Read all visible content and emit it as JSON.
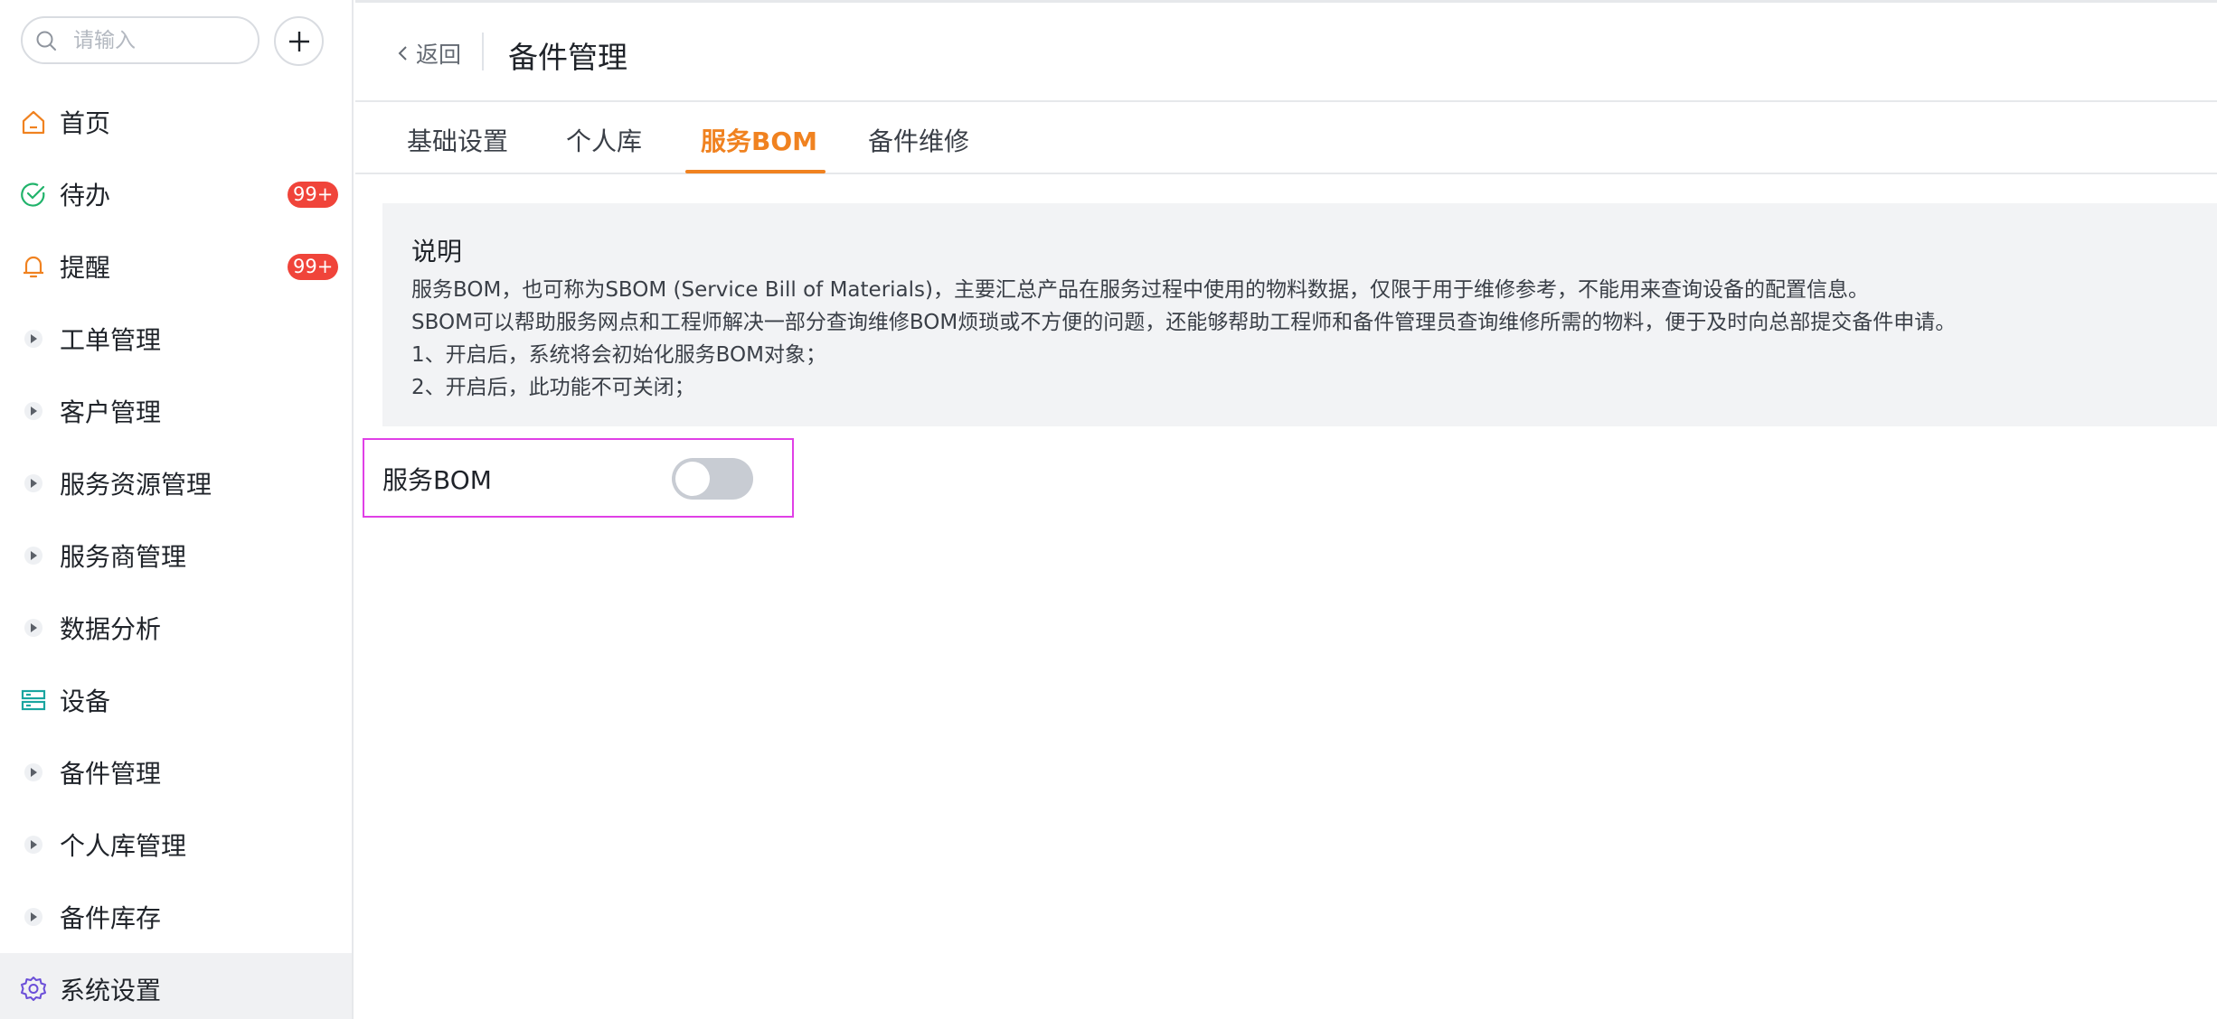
{
  "search": {
    "placeholder": "请输入"
  },
  "nav": {
    "items": [
      {
        "label": "首页",
        "icon": "home-icon"
      },
      {
        "label": "待办",
        "icon": "check-circle-icon",
        "badge": "99+"
      },
      {
        "label": "提醒",
        "icon": "bell-icon",
        "badge": "99+"
      },
      {
        "label": "工单管理",
        "icon": "caret-right-icon"
      },
      {
        "label": "客户管理",
        "icon": "caret-right-icon"
      },
      {
        "label": "服务资源管理",
        "icon": "caret-right-icon"
      },
      {
        "label": "服务商管理",
        "icon": "caret-right-icon"
      },
      {
        "label": "数据分析",
        "icon": "caret-right-icon"
      },
      {
        "label": "设备",
        "icon": "server-icon"
      },
      {
        "label": "备件管理",
        "icon": "caret-right-icon"
      },
      {
        "label": "个人库管理",
        "icon": "caret-right-icon"
      },
      {
        "label": "备件库存",
        "icon": "caret-right-icon"
      },
      {
        "label": "系统设置",
        "icon": "gear-icon",
        "active": true
      }
    ]
  },
  "header": {
    "back_label": "返回",
    "title": "备件管理"
  },
  "tabs": [
    "基础设置",
    "个人库",
    "服务BOM",
    "备件维修"
  ],
  "active_tab": "服务BOM",
  "info": {
    "title": "说明",
    "lines": [
      "服务BOM，也可称为SBOM (Service Bill of Materials)，主要汇总产品在服务过程中使用的物料数据，仅限于用于维修参考，不能用来查询设备的配置信息。",
      "SBOM可以帮助服务网点和工程师解决一部分查询维修BOM烦琐或不方便的问题，还能够帮助工程师和备件管理员查询维修所需的物料，便于及时向总部提交备件申请。",
      "1、开启后，系统将会初始化服务BOM对象；",
      "2、开启后，此功能不可关闭；"
    ]
  },
  "setting": {
    "label": "服务BOM",
    "enabled": false
  },
  "colors": {
    "accent": "#f08220",
    "badge": "#f0443a",
    "home_icon": "#f08220",
    "todo_icon": "#21b36b",
    "bell_icon": "#f08220",
    "device_icon": "#1aa5a0",
    "gear_icon": "#6b4fd8",
    "highlight_border": "#e040e6"
  }
}
